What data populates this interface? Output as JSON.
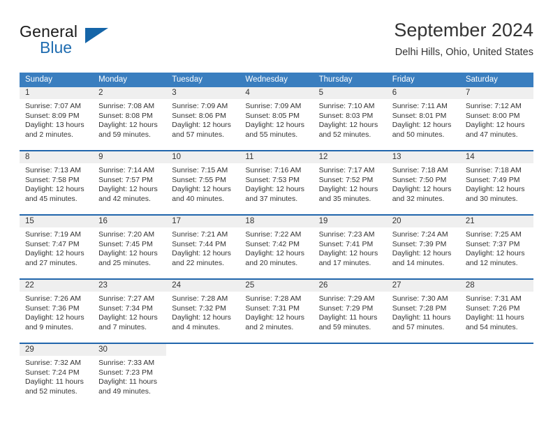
{
  "brand": {
    "name_part1": "General",
    "name_part2": "Blue",
    "flag_icon": "triangle-flag-icon"
  },
  "header": {
    "title": "September 2024",
    "subtitle": "Delhi Hills, Ohio, United States"
  },
  "weekdays": [
    "Sunday",
    "Monday",
    "Tuesday",
    "Wednesday",
    "Thursday",
    "Friday",
    "Saturday"
  ],
  "colors": {
    "header_blue": "#3a7ebf",
    "row_border_blue": "#2166ac",
    "day_band_gray": "#efefef",
    "brand_blue": "#1f6cb0",
    "text": "#333333"
  },
  "weeks": [
    [
      {
        "day": "1",
        "sunrise": "Sunrise: 7:07 AM",
        "sunset": "Sunset: 8:09 PM",
        "daylight_line1": "Daylight: 13 hours",
        "daylight_line2": "and 2 minutes."
      },
      {
        "day": "2",
        "sunrise": "Sunrise: 7:08 AM",
        "sunset": "Sunset: 8:08 PM",
        "daylight_line1": "Daylight: 12 hours",
        "daylight_line2": "and 59 minutes."
      },
      {
        "day": "3",
        "sunrise": "Sunrise: 7:09 AM",
        "sunset": "Sunset: 8:06 PM",
        "daylight_line1": "Daylight: 12 hours",
        "daylight_line2": "and 57 minutes."
      },
      {
        "day": "4",
        "sunrise": "Sunrise: 7:09 AM",
        "sunset": "Sunset: 8:05 PM",
        "daylight_line1": "Daylight: 12 hours",
        "daylight_line2": "and 55 minutes."
      },
      {
        "day": "5",
        "sunrise": "Sunrise: 7:10 AM",
        "sunset": "Sunset: 8:03 PM",
        "daylight_line1": "Daylight: 12 hours",
        "daylight_line2": "and 52 minutes."
      },
      {
        "day": "6",
        "sunrise": "Sunrise: 7:11 AM",
        "sunset": "Sunset: 8:01 PM",
        "daylight_line1": "Daylight: 12 hours",
        "daylight_line2": "and 50 minutes."
      },
      {
        "day": "7",
        "sunrise": "Sunrise: 7:12 AM",
        "sunset": "Sunset: 8:00 PM",
        "daylight_line1": "Daylight: 12 hours",
        "daylight_line2": "and 47 minutes."
      }
    ],
    [
      {
        "day": "8",
        "sunrise": "Sunrise: 7:13 AM",
        "sunset": "Sunset: 7:58 PM",
        "daylight_line1": "Daylight: 12 hours",
        "daylight_line2": "and 45 minutes."
      },
      {
        "day": "9",
        "sunrise": "Sunrise: 7:14 AM",
        "sunset": "Sunset: 7:57 PM",
        "daylight_line1": "Daylight: 12 hours",
        "daylight_line2": "and 42 minutes."
      },
      {
        "day": "10",
        "sunrise": "Sunrise: 7:15 AM",
        "sunset": "Sunset: 7:55 PM",
        "daylight_line1": "Daylight: 12 hours",
        "daylight_line2": "and 40 minutes."
      },
      {
        "day": "11",
        "sunrise": "Sunrise: 7:16 AM",
        "sunset": "Sunset: 7:53 PM",
        "daylight_line1": "Daylight: 12 hours",
        "daylight_line2": "and 37 minutes."
      },
      {
        "day": "12",
        "sunrise": "Sunrise: 7:17 AM",
        "sunset": "Sunset: 7:52 PM",
        "daylight_line1": "Daylight: 12 hours",
        "daylight_line2": "and 35 minutes."
      },
      {
        "day": "13",
        "sunrise": "Sunrise: 7:18 AM",
        "sunset": "Sunset: 7:50 PM",
        "daylight_line1": "Daylight: 12 hours",
        "daylight_line2": "and 32 minutes."
      },
      {
        "day": "14",
        "sunrise": "Sunrise: 7:18 AM",
        "sunset": "Sunset: 7:49 PM",
        "daylight_line1": "Daylight: 12 hours",
        "daylight_line2": "and 30 minutes."
      }
    ],
    [
      {
        "day": "15",
        "sunrise": "Sunrise: 7:19 AM",
        "sunset": "Sunset: 7:47 PM",
        "daylight_line1": "Daylight: 12 hours",
        "daylight_line2": "and 27 minutes."
      },
      {
        "day": "16",
        "sunrise": "Sunrise: 7:20 AM",
        "sunset": "Sunset: 7:45 PM",
        "daylight_line1": "Daylight: 12 hours",
        "daylight_line2": "and 25 minutes."
      },
      {
        "day": "17",
        "sunrise": "Sunrise: 7:21 AM",
        "sunset": "Sunset: 7:44 PM",
        "daylight_line1": "Daylight: 12 hours",
        "daylight_line2": "and 22 minutes."
      },
      {
        "day": "18",
        "sunrise": "Sunrise: 7:22 AM",
        "sunset": "Sunset: 7:42 PM",
        "daylight_line1": "Daylight: 12 hours",
        "daylight_line2": "and 20 minutes."
      },
      {
        "day": "19",
        "sunrise": "Sunrise: 7:23 AM",
        "sunset": "Sunset: 7:41 PM",
        "daylight_line1": "Daylight: 12 hours",
        "daylight_line2": "and 17 minutes."
      },
      {
        "day": "20",
        "sunrise": "Sunrise: 7:24 AM",
        "sunset": "Sunset: 7:39 PM",
        "daylight_line1": "Daylight: 12 hours",
        "daylight_line2": "and 14 minutes."
      },
      {
        "day": "21",
        "sunrise": "Sunrise: 7:25 AM",
        "sunset": "Sunset: 7:37 PM",
        "daylight_line1": "Daylight: 12 hours",
        "daylight_line2": "and 12 minutes."
      }
    ],
    [
      {
        "day": "22",
        "sunrise": "Sunrise: 7:26 AM",
        "sunset": "Sunset: 7:36 PM",
        "daylight_line1": "Daylight: 12 hours",
        "daylight_line2": "and 9 minutes."
      },
      {
        "day": "23",
        "sunrise": "Sunrise: 7:27 AM",
        "sunset": "Sunset: 7:34 PM",
        "daylight_line1": "Daylight: 12 hours",
        "daylight_line2": "and 7 minutes."
      },
      {
        "day": "24",
        "sunrise": "Sunrise: 7:28 AM",
        "sunset": "Sunset: 7:32 PM",
        "daylight_line1": "Daylight: 12 hours",
        "daylight_line2": "and 4 minutes."
      },
      {
        "day": "25",
        "sunrise": "Sunrise: 7:28 AM",
        "sunset": "Sunset: 7:31 PM",
        "daylight_line1": "Daylight: 12 hours",
        "daylight_line2": "and 2 minutes."
      },
      {
        "day": "26",
        "sunrise": "Sunrise: 7:29 AM",
        "sunset": "Sunset: 7:29 PM",
        "daylight_line1": "Daylight: 11 hours",
        "daylight_line2": "and 59 minutes."
      },
      {
        "day": "27",
        "sunrise": "Sunrise: 7:30 AM",
        "sunset": "Sunset: 7:28 PM",
        "daylight_line1": "Daylight: 11 hours",
        "daylight_line2": "and 57 minutes."
      },
      {
        "day": "28",
        "sunrise": "Sunrise: 7:31 AM",
        "sunset": "Sunset: 7:26 PM",
        "daylight_line1": "Daylight: 11 hours",
        "daylight_line2": "and 54 minutes."
      }
    ],
    [
      {
        "day": "29",
        "sunrise": "Sunrise: 7:32 AM",
        "sunset": "Sunset: 7:24 PM",
        "daylight_line1": "Daylight: 11 hours",
        "daylight_line2": "and 52 minutes."
      },
      {
        "day": "30",
        "sunrise": "Sunrise: 7:33 AM",
        "sunset": "Sunset: 7:23 PM",
        "daylight_line1": "Daylight: 11 hours",
        "daylight_line2": "and 49 minutes."
      },
      {
        "day": "",
        "sunrise": "",
        "sunset": "",
        "daylight_line1": "",
        "daylight_line2": ""
      },
      {
        "day": "",
        "sunrise": "",
        "sunset": "",
        "daylight_line1": "",
        "daylight_line2": ""
      },
      {
        "day": "",
        "sunrise": "",
        "sunset": "",
        "daylight_line1": "",
        "daylight_line2": ""
      },
      {
        "day": "",
        "sunrise": "",
        "sunset": "",
        "daylight_line1": "",
        "daylight_line2": ""
      },
      {
        "day": "",
        "sunrise": "",
        "sunset": "",
        "daylight_line1": "",
        "daylight_line2": ""
      }
    ]
  ]
}
